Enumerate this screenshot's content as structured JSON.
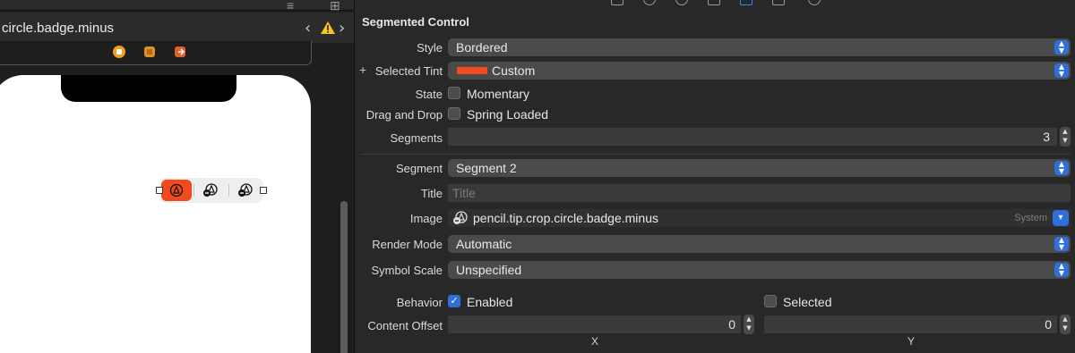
{
  "canvas": {
    "file_title": "circle.badge.minus",
    "nav_back": "‹",
    "nav_forward": "›"
  },
  "inspector": {
    "section_title": "Segmented Control",
    "style": {
      "label": "Style",
      "value": "Bordered"
    },
    "selected_tint": {
      "label": "Selected Tint",
      "value": "Custom",
      "swatch_color": "#f04a1e"
    },
    "state": {
      "label": "State",
      "option": "Momentary",
      "checked": false
    },
    "drag_and_drop": {
      "label": "Drag and Drop",
      "option": "Spring Loaded",
      "checked": false
    },
    "segments": {
      "label": "Segments",
      "value": "3"
    },
    "segment": {
      "label": "Segment",
      "value": "Segment 2"
    },
    "title": {
      "label": "Title",
      "placeholder": "Title"
    },
    "image": {
      "label": "Image",
      "value": "pencil.tip.crop.circle.badge.minus",
      "source": "System"
    },
    "render_mode": {
      "label": "Render Mode",
      "value": "Automatic"
    },
    "symbol_scale": {
      "label": "Symbol Scale",
      "value": "Unspecified"
    },
    "behavior": {
      "label": "Behavior",
      "enabled_label": "Enabled",
      "enabled": true,
      "selected_label": "Selected",
      "selected": false
    },
    "content_offset": {
      "label": "Content Offset",
      "x_value": "0",
      "y_value": "0",
      "x_label": "X",
      "y_label": "Y"
    }
  },
  "colors": {
    "accent": "#2f6fd8",
    "tint": "#f04a1e",
    "panel": "#282828"
  }
}
